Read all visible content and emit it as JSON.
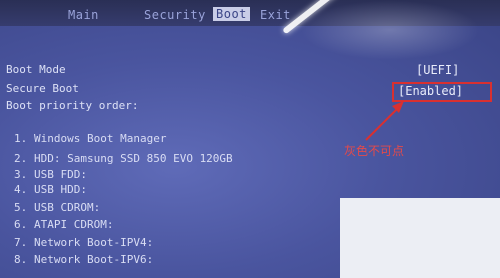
{
  "tabs": [
    {
      "label": "Main"
    },
    {
      "label": "Security"
    },
    {
      "label": "Boot"
    },
    {
      "label": "Exit"
    }
  ],
  "settings": {
    "boot_mode_label": "Boot Mode",
    "boot_mode_value": "[UEFI]",
    "secure_boot_label": "Secure Boot",
    "secure_boot_value": "[Enabled]",
    "boot_priority_label": "Boot priority order:"
  },
  "boot_order": [
    {
      "num": "1.",
      "name": "Windows Boot Manager"
    },
    {
      "num": "2.",
      "name": "HDD: Samsung SSD 850 EVO 120GB"
    },
    {
      "num": "3.",
      "name": "USB FDD:"
    },
    {
      "num": "4.",
      "name": "USB HDD:"
    },
    {
      "num": "5.",
      "name": "USB CDROM:"
    },
    {
      "num": "6.",
      "name": "ATAPI CDROM:"
    },
    {
      "num": "7.",
      "name": "Network Boot-IPV4:"
    },
    {
      "num": "8.",
      "name": "Network Boot-IPV6:"
    }
  ],
  "annotation": {
    "text": "灰色不可点",
    "color": "#e44a4a"
  }
}
